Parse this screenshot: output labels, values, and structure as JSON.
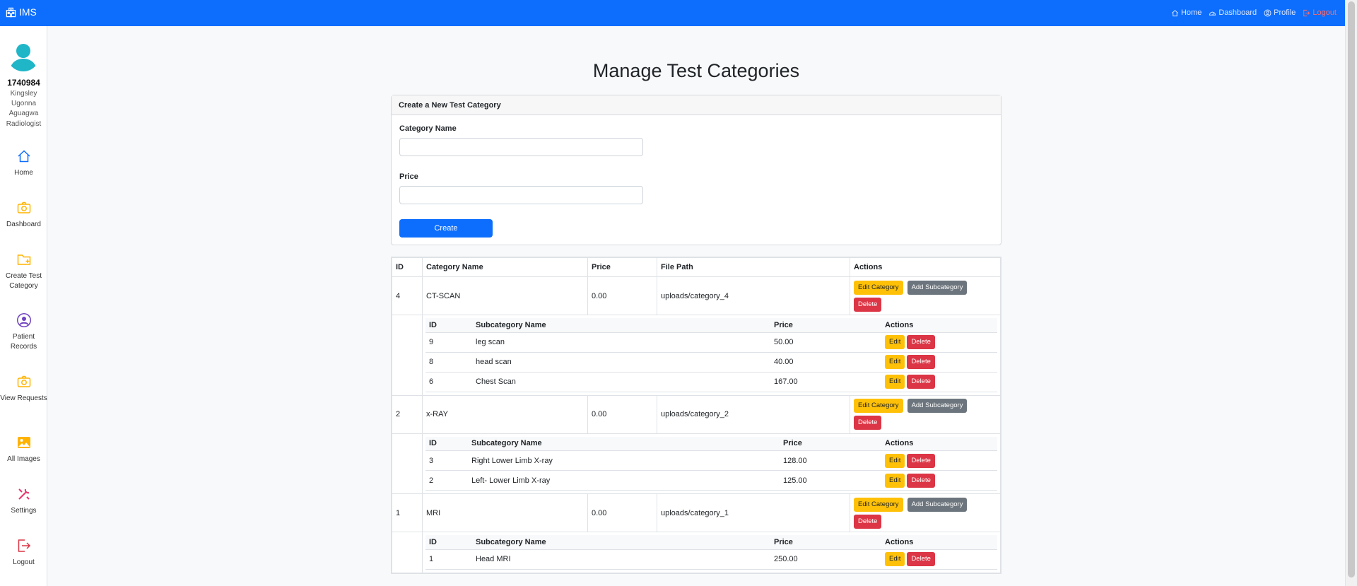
{
  "navbar": {
    "brand": "IMS",
    "links": [
      {
        "label": "Home",
        "icon": "home-icon"
      },
      {
        "label": "Dashboard",
        "icon": "dashboard-icon"
      },
      {
        "label": "Profile",
        "icon": "profile-icon"
      },
      {
        "label": "Logout",
        "icon": "logout-icon"
      }
    ]
  },
  "user": {
    "id": "1740984",
    "name_lines": [
      "Kingsley",
      "Ugonna",
      "Aguagwa"
    ],
    "role": "Radiologist"
  },
  "sidebar": {
    "items": [
      {
        "label": "Home",
        "icon": "home-icon"
      },
      {
        "label": "Dashboard",
        "icon": "camera-icon"
      },
      {
        "label": "Create Test Category",
        "icon": "folder-plus-icon"
      },
      {
        "label": "Patient Records",
        "icon": "user-circle-icon"
      },
      {
        "label": "View Requests",
        "icon": "camera-icon"
      },
      {
        "label": "All Images",
        "icon": "image-icon"
      },
      {
        "label": "Settings",
        "icon": "tools-icon"
      },
      {
        "label": "Logout",
        "icon": "logout-icon"
      }
    ]
  },
  "page": {
    "title": "Manage Test Categories"
  },
  "form": {
    "header": "Create a New Test Category",
    "category_label": "Category Name",
    "category_value": "",
    "price_label": "Price",
    "price_value": "",
    "submit_label": "Create"
  },
  "table": {
    "headers": [
      "ID",
      "Category Name",
      "Price",
      "File Path",
      "Actions"
    ],
    "sub_headers": [
      "ID",
      "Subcategory Name",
      "Price",
      "Actions"
    ],
    "buttons": {
      "edit_category": "Edit Category",
      "add_subcategory": "Add Subcategory",
      "delete": "Delete",
      "edit": "Edit"
    },
    "categories": [
      {
        "id": "4",
        "name": "CT-SCAN",
        "price": "0.00",
        "file_path": "uploads/category_4",
        "subcategories": [
          {
            "id": "9",
            "name": "leg scan",
            "price": "50.00"
          },
          {
            "id": "8",
            "name": "head scan",
            "price": "40.00"
          },
          {
            "id": "6",
            "name": "Chest Scan",
            "price": "167.00"
          }
        ]
      },
      {
        "id": "2",
        "name": "x-RAY",
        "price": "0.00",
        "file_path": "uploads/category_2",
        "subcategories": [
          {
            "id": "3",
            "name": "Right Lower Limb X-ray",
            "price": "128.00"
          },
          {
            "id": "2",
            "name": "Left- Lower Limb X-ray",
            "price": "125.00"
          }
        ]
      },
      {
        "id": "1",
        "name": "MRI",
        "price": "0.00",
        "file_path": "uploads/category_1",
        "subcategories": [
          {
            "id": "1",
            "name": "Head MRI",
            "price": "250.00"
          }
        ]
      }
    ]
  },
  "colors": {
    "primary": "#0d6efd",
    "warning": "#ffc107",
    "secondary": "#6c757d",
    "danger": "#dc3545",
    "avatar": "#1fb6c8"
  }
}
